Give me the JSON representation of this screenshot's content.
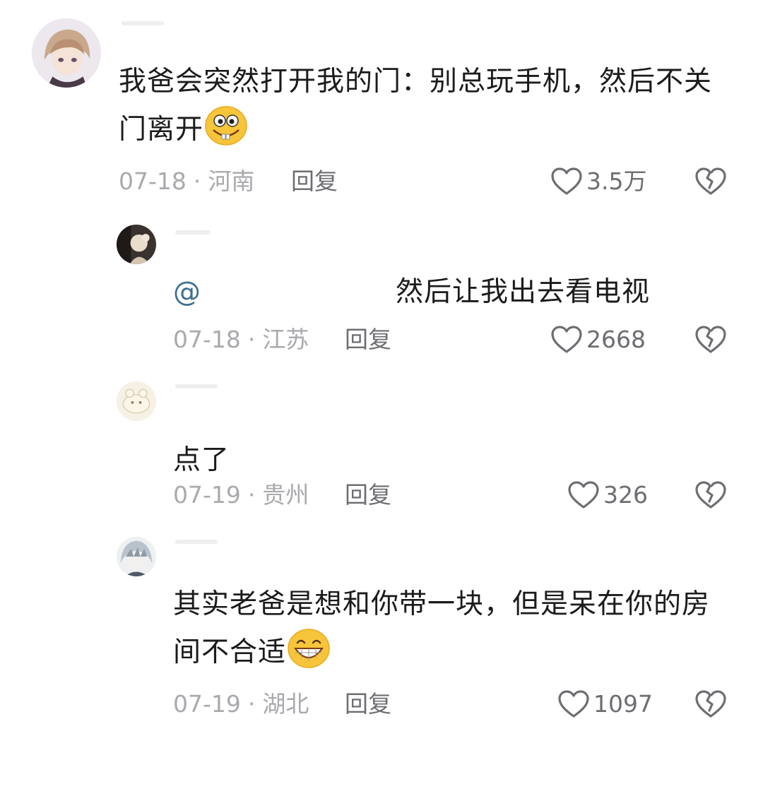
{
  "comments": [
    {
      "text_line1": "我爸会突然打开我的门：别总玩手机，然后不关",
      "text_line2": "门离开",
      "emoji": "silly-grin-emoji",
      "date": "07-18",
      "sep": "·",
      "location": "河南",
      "reply": "回复",
      "likes": "3.5万"
    },
    {
      "mention": "@",
      "text": "然后让我出去看电视",
      "date": "07-18",
      "sep": "·",
      "location": "江苏",
      "reply": "回复",
      "likes": "2668"
    },
    {
      "text": "点了",
      "date": "07-19",
      "sep": "·",
      "location": "贵州",
      "reply": "回复",
      "likes": "326"
    },
    {
      "text_line1": "其实老爸是想和你带一块，但是呆在你的房",
      "text_line2": "间不合适",
      "emoji": "big-grin-emoji",
      "date": "07-19",
      "sep": "·",
      "location": "湖北",
      "reply": "回复",
      "likes": "1097"
    }
  ],
  "icons": {
    "like": "heart-outline-icon",
    "dislike": "broken-heart-icon"
  },
  "colors": {
    "text": "#1b1b1b",
    "meta": "#a9a9ae",
    "action": "#6d6d72",
    "mention": "#3f6f8f"
  }
}
